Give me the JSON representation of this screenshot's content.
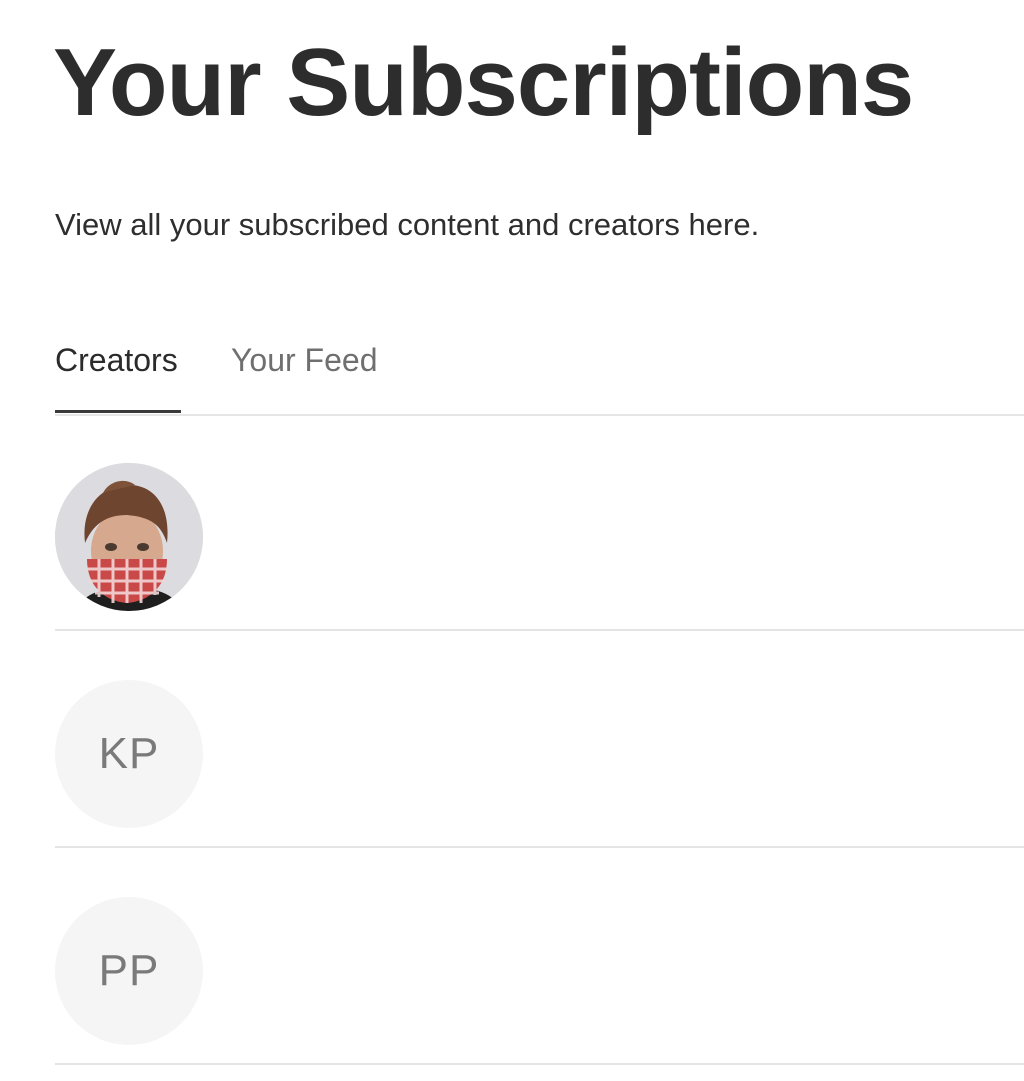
{
  "header": {
    "title": "Your Subscriptions",
    "subtitle": "View all your subscribed content and creators here."
  },
  "tabs": [
    {
      "label": "Creators",
      "active": true
    },
    {
      "label": "Your Feed",
      "active": false
    }
  ],
  "creators": [
    {
      "avatar_type": "photo",
      "initials": ""
    },
    {
      "avatar_type": "initials",
      "initials": "KP"
    },
    {
      "avatar_type": "initials",
      "initials": "PP"
    }
  ],
  "colors": {
    "title_text": "#2d2d2d",
    "inactive_tab_text": "#6f6f6f",
    "divider": "#e4e4e4",
    "avatar_placeholder_bg": "#f5f5f5",
    "avatar_initials_text": "#7a7a7a"
  }
}
